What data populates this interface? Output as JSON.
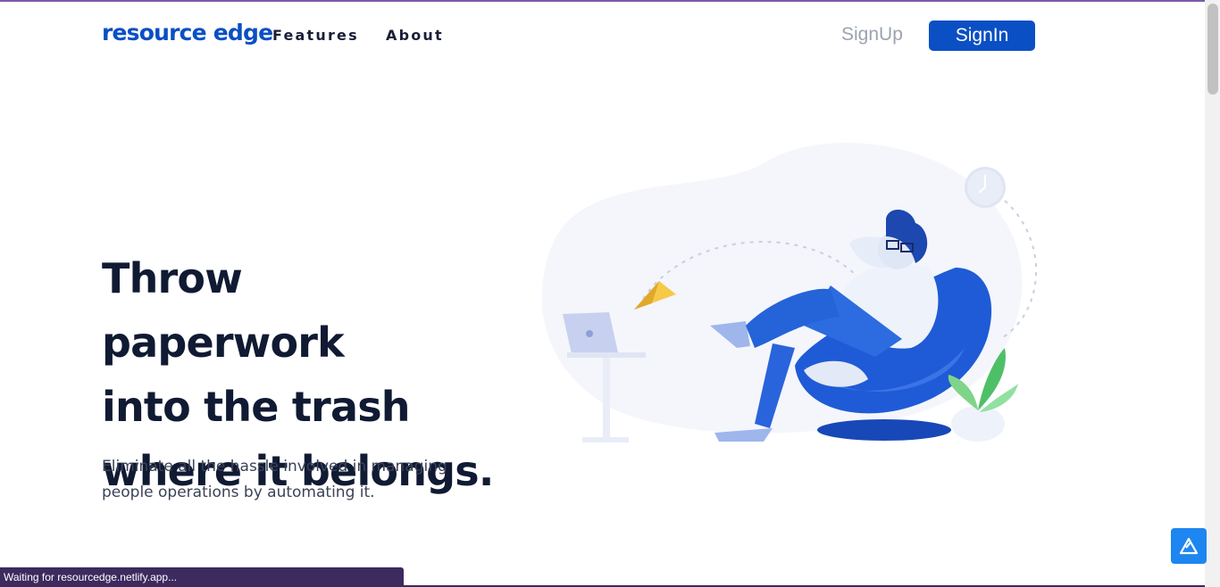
{
  "header": {
    "logo_text": "resource edge",
    "nav": [
      {
        "label": "Features"
      },
      {
        "label": "About"
      }
    ],
    "signup_label": "SignUp",
    "signin_label": "SignIn"
  },
  "hero": {
    "title_lines": [
      "Throw paperwork",
      "into the trash",
      "where it belongs."
    ],
    "subtitle_lines": [
      "Eliminate all the hassle involved in managing",
      "people operations by automating it."
    ],
    "illustration": "man-relaxing-in-beanbag-illustration"
  },
  "help_widget": {
    "icon": "help-widget-icon"
  },
  "status_bar": {
    "text": "Waiting for resourcedge.netlify.app..."
  },
  "colors": {
    "brand_blue": "#0a4fc4",
    "heading": "#101a33",
    "muted": "#9aa3b2",
    "status_bar": "#3d2a5e",
    "help_widget": "#1e86f0",
    "accent_line": "#7a5aa8"
  }
}
